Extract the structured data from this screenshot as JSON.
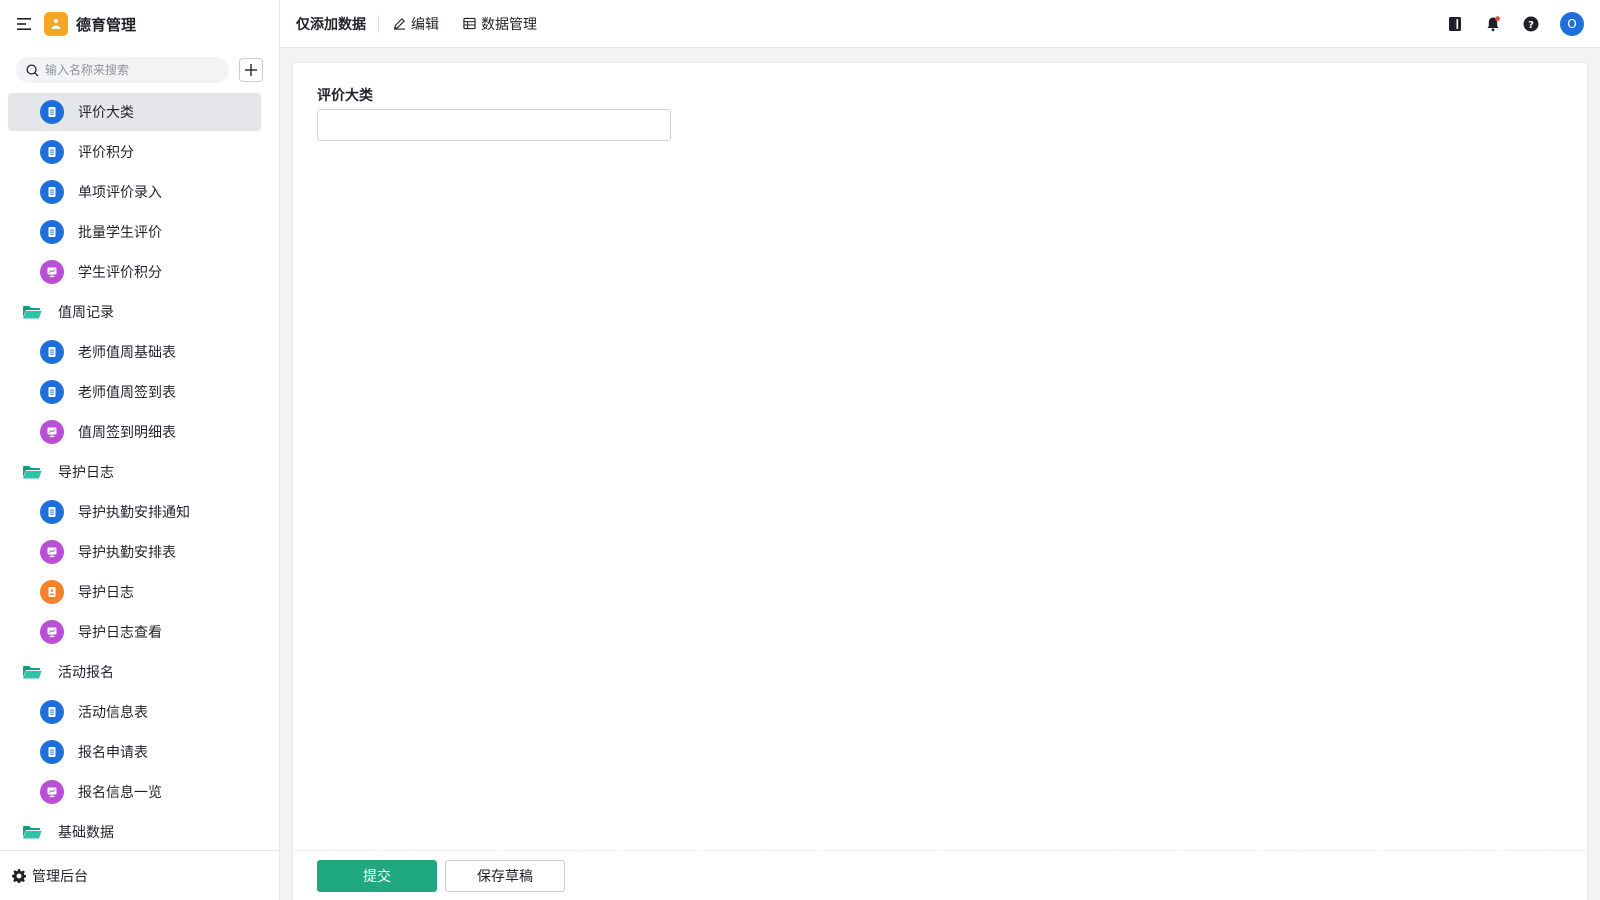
{
  "app": {
    "title": "德育管理",
    "brand_color": "#f5a623"
  },
  "sidebar": {
    "search": {
      "placeholder": "输入名称来搜索",
      "value": ""
    },
    "items": [
      {
        "label": "评价大类",
        "type": "form",
        "icon": "form-icon",
        "color": "#1e6fd9",
        "active": true
      },
      {
        "label": "评价积分",
        "type": "form",
        "icon": "form-icon",
        "color": "#1e6fd9"
      },
      {
        "label": "单项评价录入",
        "type": "form",
        "icon": "form-icon",
        "color": "#1e6fd9"
      },
      {
        "label": "批量学生评价",
        "type": "form",
        "icon": "form-icon",
        "color": "#1e6fd9"
      },
      {
        "label": "学生评价积分",
        "type": "report",
        "icon": "report-icon",
        "color": "#b94fd6"
      },
      {
        "label": "值周记录",
        "type": "folder",
        "icon": "folder-icon",
        "color": "#14b8a0"
      },
      {
        "label": "老师值周基础表",
        "type": "form",
        "icon": "form-icon",
        "color": "#1e6fd9"
      },
      {
        "label": "老师值周签到表",
        "type": "form",
        "icon": "form-icon",
        "color": "#1e6fd9"
      },
      {
        "label": "值周签到明细表",
        "type": "report",
        "icon": "report-icon",
        "color": "#b94fd6"
      },
      {
        "label": "导护日志",
        "type": "folder",
        "icon": "folder-icon",
        "color": "#14b8a0"
      },
      {
        "label": "导护执勤安排通知",
        "type": "form",
        "icon": "form-icon",
        "color": "#1e6fd9"
      },
      {
        "label": "导护执勤安排表",
        "type": "report",
        "icon": "report-icon",
        "color": "#b94fd6"
      },
      {
        "label": "导护日志",
        "type": "flow",
        "icon": "flow-form-icon",
        "color": "#f5812b"
      },
      {
        "label": "导护日志查看",
        "type": "report",
        "icon": "report-icon",
        "color": "#b94fd6"
      },
      {
        "label": "活动报名",
        "type": "folder",
        "icon": "folder-icon",
        "color": "#14b8a0"
      },
      {
        "label": "活动信息表",
        "type": "form",
        "icon": "form-icon",
        "color": "#1e6fd9"
      },
      {
        "label": "报名申请表",
        "type": "form",
        "icon": "form-icon",
        "color": "#1e6fd9"
      },
      {
        "label": "报名信息一览",
        "type": "report",
        "icon": "report-icon",
        "color": "#b94fd6"
      },
      {
        "label": "基础数据",
        "type": "folder",
        "icon": "folder-icon",
        "color": "#14b8a0"
      }
    ],
    "footer_label": "管理后台"
  },
  "topbar": {
    "page_title": "仅添加数据",
    "edit_label": "编辑",
    "data_manage_label": "数据管理",
    "avatar_initial": "O"
  },
  "form": {
    "field_label": "评价大类",
    "field_value": "",
    "submit_label": "提交",
    "save_draft_label": "保存草稿",
    "primary_color": "#20a87e"
  }
}
